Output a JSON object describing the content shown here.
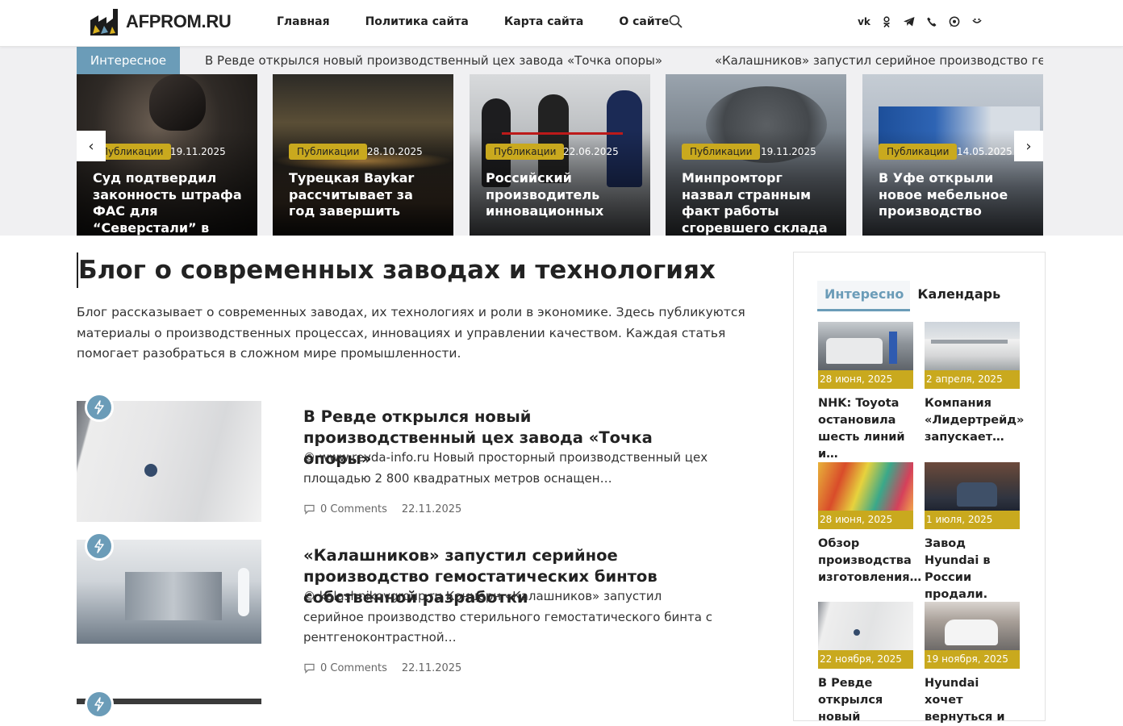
{
  "header": {
    "logo_text": "AFPROM.RU",
    "nav": [
      "Главная",
      "Политика сайта",
      "Карта сайта",
      "О сайте"
    ],
    "socials": [
      "vk-icon",
      "ok-icon",
      "telegram-icon",
      "viber-icon",
      "whatsapp-icon",
      "messenger-icon"
    ]
  },
  "ticker": {
    "label": "Интересное",
    "items": [
      "В Ревде открылся новый производственный цех завода «Точка опоры»",
      "«Калашников» запустил серийное производство гемостатических бинтов собственной разработки"
    ]
  },
  "slider": {
    "prev": "‹",
    "next": "›",
    "cards": [
      {
        "tag": "Публикации",
        "date": "19.11.2025",
        "title": "Суд подтвердил законность штрафа ФАС для “Северстали” в"
      },
      {
        "tag": "Публикации",
        "date": "28.10.2025",
        "title": "Турецкая Baykar рассчитывает за год завершить"
      },
      {
        "tag": "Публикации",
        "date": "22.06.2025",
        "title": "Российский производитель инновационных"
      },
      {
        "tag": "Публикации",
        "date": "19.11.2025",
        "title": "Минпромторг назвал странным факт работы сгоревшего склада"
      },
      {
        "tag": "Публикации",
        "date": "14.05.2025",
        "title": "В Уфе открыли новое мебельное производство"
      }
    ]
  },
  "main": {
    "title": "Блог о современных заводах и технологиях",
    "intro": "Блог рассказывает о современных заводах, их технологиях и роли в экономике. Здесь публикуются материалы о производственных процессах, инновациях и управлении качеством. Каждая статья помогает разобраться в сложном мире промышленности.",
    "posts": [
      {
        "title": "В Ревде открылся новый производственный цех завода «Точка опоры»",
        "excerpt": " © www.revda-info.ru Новый просторный производственный цех площадью 2 800 квадратных метров оснащен…",
        "comments": "0 Comments",
        "date": "22.11.2025"
      },
      {
        "title": "«Калашников» запустил серийное производство гемостатических бинтов собственной разработки",
        "excerpt": " © kalashnikovgroup.ru Концерн «Калашников» запустил серийное производство стерильного гемостатического бинта с рентгеноконтрастной…",
        "comments": "0 Comments",
        "date": "22.11.2025"
      }
    ]
  },
  "sidebar": {
    "tabs": [
      "Интересно",
      "Календарь"
    ],
    "items": [
      {
        "date": "28 июня, 2025",
        "title": "NHK: Toyota остановила шесть линий и…"
      },
      {
        "date": "2 апреля, 2025",
        "title": "Компания «Лидертрейд» запускает…"
      },
      {
        "date": "28 июня, 2025",
        "title": "Обзор производства изготовления…"
      },
      {
        "date": "1 июля, 2025",
        "title": "Завод Hyundai в России продали. Его…"
      },
      {
        "date": "22 ноября, 2025",
        "title": "В Ревде открылся новый"
      },
      {
        "date": "19 ноября, 2025",
        "title": "Hyundai хочет вернуться и"
      }
    ]
  },
  "colors": {
    "accent": "#6b9cb8",
    "tag": "#c9a91e"
  }
}
